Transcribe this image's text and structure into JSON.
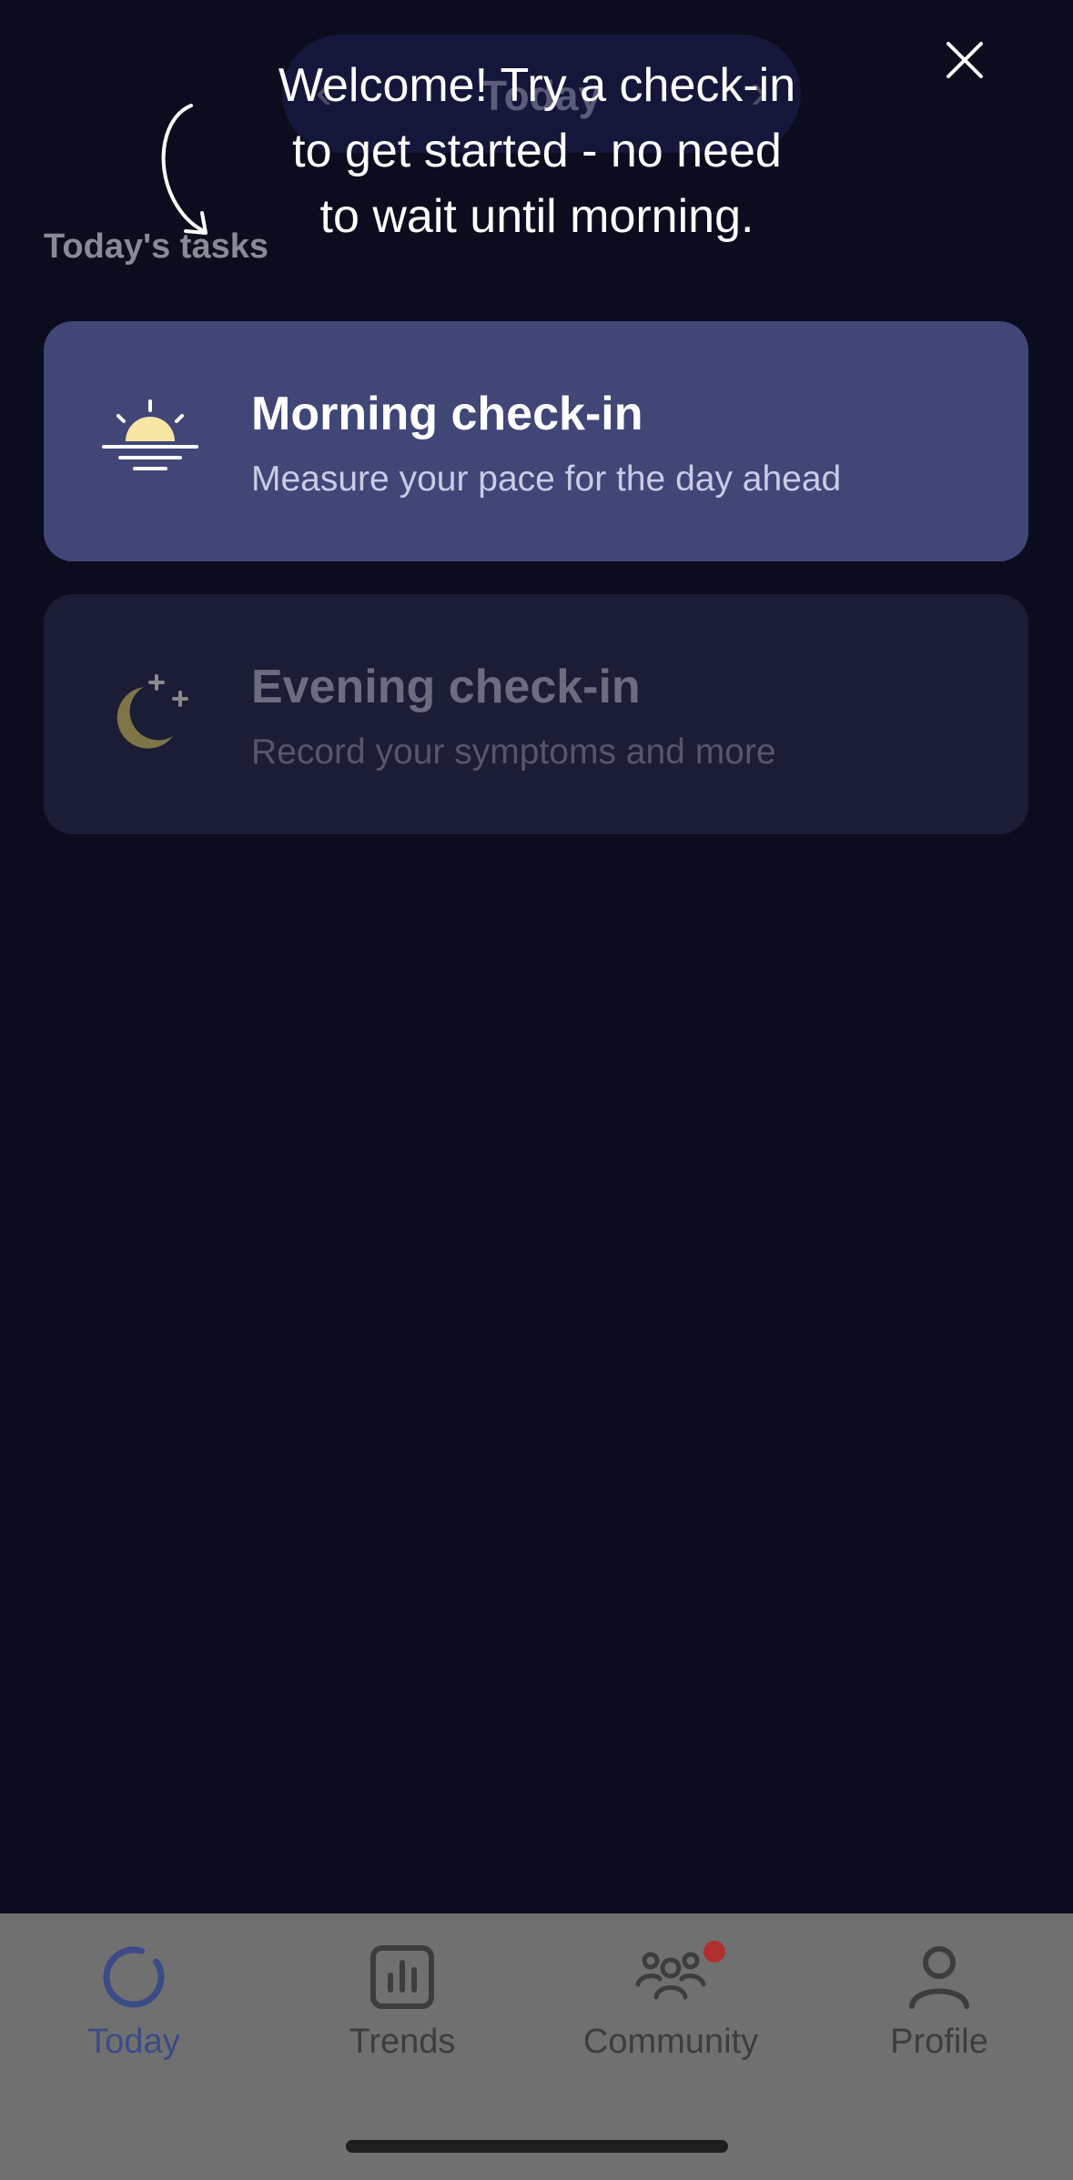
{
  "header": {
    "date_label": "Today",
    "prev_label": "‹",
    "next_label": "›"
  },
  "tasks": {
    "section_title": "Today's tasks",
    "items": [
      {
        "title": "Morning check-in",
        "subtitle": "Measure your pace for the day ahead",
        "icon": "sunrise-icon"
      },
      {
        "title": "Evening check-in",
        "subtitle": "Record your symptoms and more",
        "icon": "moon-stars-icon"
      }
    ]
  },
  "tooltip": {
    "line1": "Welcome! Try a check-in",
    "line2": "to get started - no need",
    "line3": "to wait until morning.",
    "close_icon": "close-icon",
    "arrow_icon": "curved-arrow-icon"
  },
  "tabbar": {
    "items": [
      {
        "label": "Today",
        "icon": "today-ring-icon",
        "active": true
      },
      {
        "label": "Trends",
        "icon": "bar-chart-icon"
      },
      {
        "label": "Community",
        "icon": "people-icon",
        "badge": true
      },
      {
        "label": "Profile",
        "icon": "person-icon"
      }
    ]
  },
  "colors": {
    "background": "#0b0c1e",
    "morning_card": "#414677",
    "evening_card": "#1b1d36",
    "tabbar": "#707070",
    "active_tab": "#3c4a86",
    "badge": "#b03030"
  }
}
